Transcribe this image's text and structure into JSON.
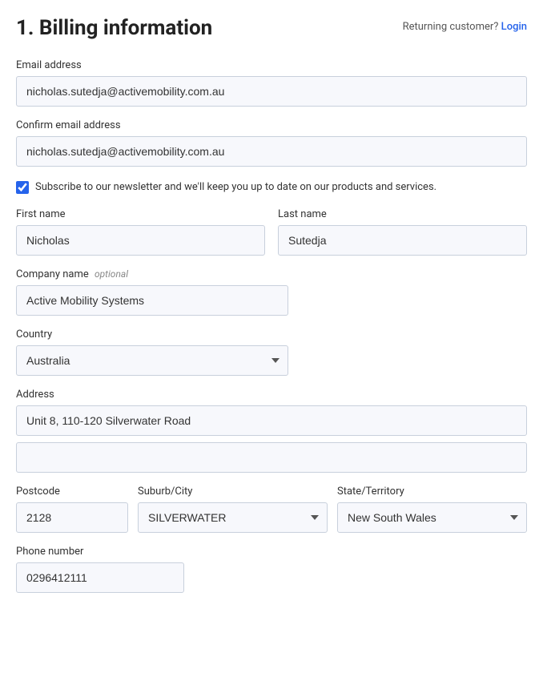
{
  "page": {
    "title": "1. Billing information",
    "returning_text": "Returning customer?",
    "login_label": "Login"
  },
  "form": {
    "email_label": "Email address",
    "email_value": "nicholas.sutedja@activemobility.com.au",
    "confirm_email_label": "Confirm email address",
    "confirm_email_value": "nicholas.sutedja@activemobility.com.au",
    "newsletter_label": "Subscribe to our newsletter and we'll keep you up to date on our products and services.",
    "first_name_label": "First name",
    "first_name_value": "Nicholas",
    "last_name_label": "Last name",
    "last_name_value": "Sutedja",
    "company_label": "Company name",
    "company_optional": "optional",
    "company_value": "Active Mobility Systems",
    "country_label": "Country",
    "country_value": "Australia",
    "address_label": "Address",
    "address_line1_value": "Unit 8, 110-120 Silverwater Road",
    "address_line2_value": "",
    "postcode_label": "Postcode",
    "postcode_value": "2128",
    "suburb_label": "Suburb/City",
    "suburb_value": "SILVERWATER",
    "state_label": "State/Territory",
    "state_value": "New South Wales",
    "phone_label": "Phone number",
    "phone_value": "0296412111"
  }
}
